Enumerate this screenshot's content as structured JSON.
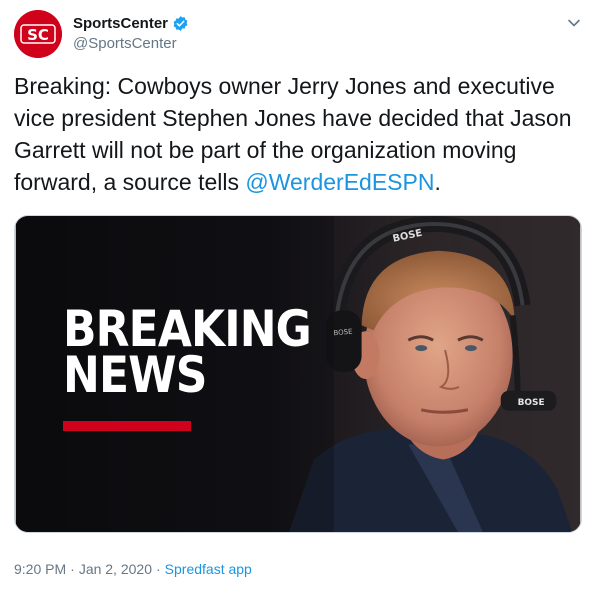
{
  "account": {
    "display_name": "SportsCenter",
    "handle": "@SportsCenter",
    "avatar_text": "SC"
  },
  "tweet": {
    "text_before_mention": "Breaking: Cowboys owner Jerry Jones and executive vice president Stephen Jones have decided that Jason Garrett will not be part of the organization moving forward, a source tells ",
    "mention": "@WerderEdESPN",
    "text_after_mention": "."
  },
  "media": {
    "headline_line1": "BREAKING",
    "headline_line2": "NEWS",
    "headset_brand": "BOSE"
  },
  "meta": {
    "time": "9:20 PM",
    "separator": "·",
    "date": "Jan 2, 2020",
    "source": "Spredfast app"
  },
  "icons": {
    "verified": "verified-badge-icon",
    "menu": "chevron-down-icon"
  },
  "colors": {
    "brand_red": "#d0021b",
    "link_blue": "#1b95e0",
    "muted_gray": "#657786",
    "verified_blue": "#1da1f2"
  }
}
